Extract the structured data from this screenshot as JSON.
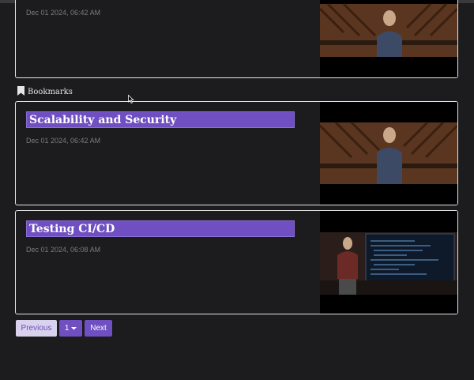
{
  "cards": [
    {
      "title": "",
      "date": "Dec 01 2024, 06:42 AM"
    }
  ],
  "bookmarks": {
    "label": "Bookmarks",
    "icon": "bookmark-icon",
    "items": [
      {
        "title": "Scalability and Security",
        "date": "Dec 01 2024, 06:42 AM"
      },
      {
        "title": "Testing CI/CD",
        "date": "Dec 01 2024, 06:08 AM"
      }
    ]
  },
  "pagination": {
    "previous_label": "Previous",
    "page_label": "1",
    "next_label": "Next"
  },
  "colors": {
    "accent": "#6f4fc1",
    "background": "#1c1b1d",
    "card_border": "#e6e6e6"
  }
}
